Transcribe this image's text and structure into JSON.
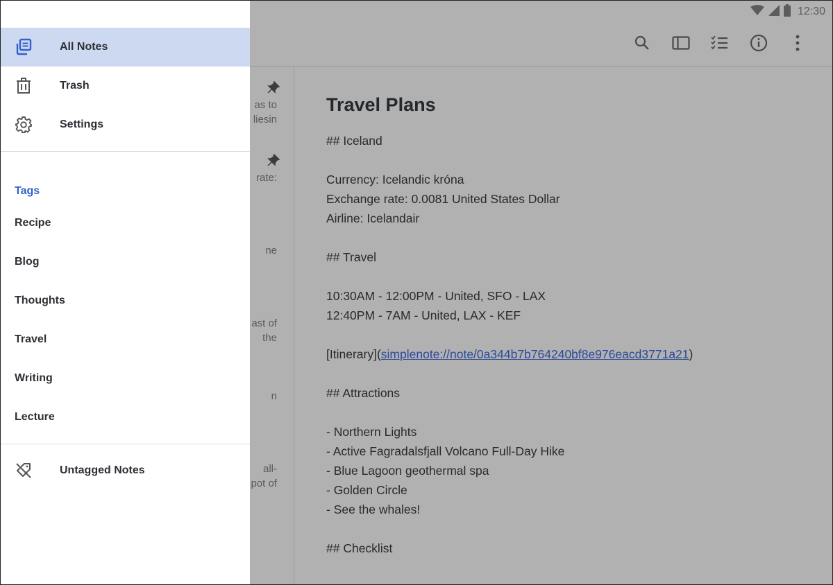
{
  "status_bar": {
    "time": "12:30",
    "icons": [
      "wifi-icon",
      "cell-signal-icon",
      "battery-icon"
    ]
  },
  "toolbar": {
    "actions": [
      {
        "name": "search",
        "icon": "search-icon"
      },
      {
        "name": "toggle-sidebar",
        "icon": "sidebar-icon"
      },
      {
        "name": "checklist",
        "icon": "checklist-icon"
      },
      {
        "name": "info",
        "icon": "info-icon"
      },
      {
        "name": "more",
        "icon": "more-vert-icon"
      }
    ]
  },
  "drawer": {
    "nav": [
      {
        "label": "All Notes",
        "icon": "all-notes-icon",
        "selected": true
      },
      {
        "label": "Trash",
        "icon": "trash-icon",
        "selected": false
      },
      {
        "label": "Settings",
        "icon": "gear-icon",
        "selected": false
      }
    ],
    "tags_header": "Tags",
    "tags": [
      "Recipe",
      "Blog",
      "Thoughts",
      "Travel",
      "Writing",
      "Lecture"
    ],
    "untagged": {
      "label": "Untagged Notes",
      "icon": "untagged-icon"
    }
  },
  "note_list": {
    "visible_fragments": [
      {
        "lines": [
          "as to",
          "liesin"
        ],
        "pinned": true
      },
      {
        "lines": [
          "rate:"
        ],
        "pinned": true
      },
      {
        "lines": [
          "ne"
        ],
        "pinned": false
      },
      {
        "lines": [
          "ast of",
          "the"
        ],
        "pinned": false
      },
      {
        "lines": [
          "n"
        ],
        "pinned": false
      },
      {
        "lines": [
          "all-",
          "pot of"
        ],
        "pinned": false
      }
    ]
  },
  "editor": {
    "title": "Travel Plans",
    "lines": [
      "## Iceland",
      "",
      "Currency: Icelandic króna",
      "Exchange rate: 0.0081 United States Dollar",
      "Airline: Icelandair",
      "",
      "## Travel",
      "",
      "10:30AM - 12:00PM - United, SFO - LAX",
      "12:40PM - 7AM - United, LAX - KEF",
      ""
    ],
    "link_line": {
      "prefix": "[Itinerary](",
      "url": "simplenote://note/0a344b7b764240bf8e976eacd3771a21",
      "suffix": ")"
    },
    "lines_after": [
      "",
      "## Attractions",
      "",
      "- Northern Lights",
      "- Active Fagradalsfjall Volcano Full-Day Hike",
      "- Blue Lagoon geothermal spa",
      "- Golden Circle",
      "- See the whales!",
      "",
      "## Checklist"
    ]
  },
  "colors": {
    "accent": "#3361cc",
    "selected_bg": "#ccd9f0",
    "scrim_bg": "#b1b1b1"
  }
}
